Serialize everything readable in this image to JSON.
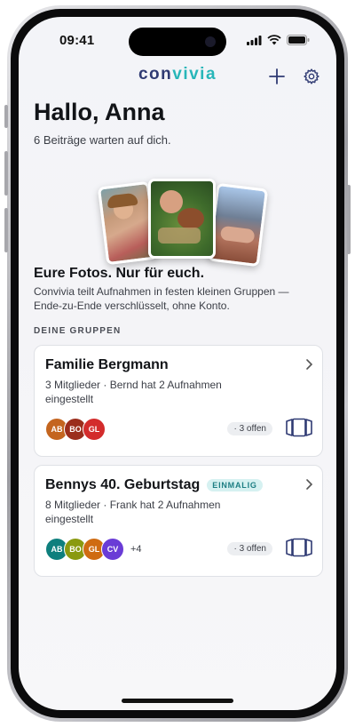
{
  "status": {
    "time": "09:41"
  },
  "app": {
    "logo_prefix": "con",
    "logo_suffix": "vivia",
    "accent": "#27b6b9",
    "brand": "#2f3a73"
  },
  "header": {
    "icons": [
      "plus-icon",
      "gear-icon"
    ]
  },
  "home": {
    "greeting": "Hallo, Anna",
    "subtitle": "6 Beiträge warten auf dich.",
    "tagline": "Eure Fotos. Nur für euch.",
    "description": "Convivia teilt Aufnahmen in festen kleinen Gruppen — Ende-zu-Ende verschlüsselt, ohne Konto.",
    "section_title": "DEINE GRUPPEN"
  },
  "groups": [
    {
      "name": "Familie Bergmann",
      "badge": "",
      "meta": "3 Mitglieder · Bernd hat 2 Aufnahmen eingestellt",
      "avatars": [
        {
          "initials": "AB",
          "color": "#c4651f"
        },
        {
          "initials": "BO",
          "color": "#9b2d1c"
        },
        {
          "initials": "GL",
          "color": "#d32c2c"
        }
      ],
      "more": "",
      "open": "· 3 offen"
    },
    {
      "name": "Bennys 40. Geburtstag",
      "badge": "EINMALIG",
      "meta": "8 Mitglieder · Frank hat 2 Aufnahmen eingestellt",
      "avatars": [
        {
          "initials": "AB",
          "color": "#0e7f7d"
        },
        {
          "initials": "BO",
          "color": "#8a9a10"
        },
        {
          "initials": "GL",
          "color": "#cf6b12"
        },
        {
          "initials": "CV",
          "color": "#6a3cd6"
        }
      ],
      "more": "+4",
      "open": "· 3 offen"
    }
  ]
}
